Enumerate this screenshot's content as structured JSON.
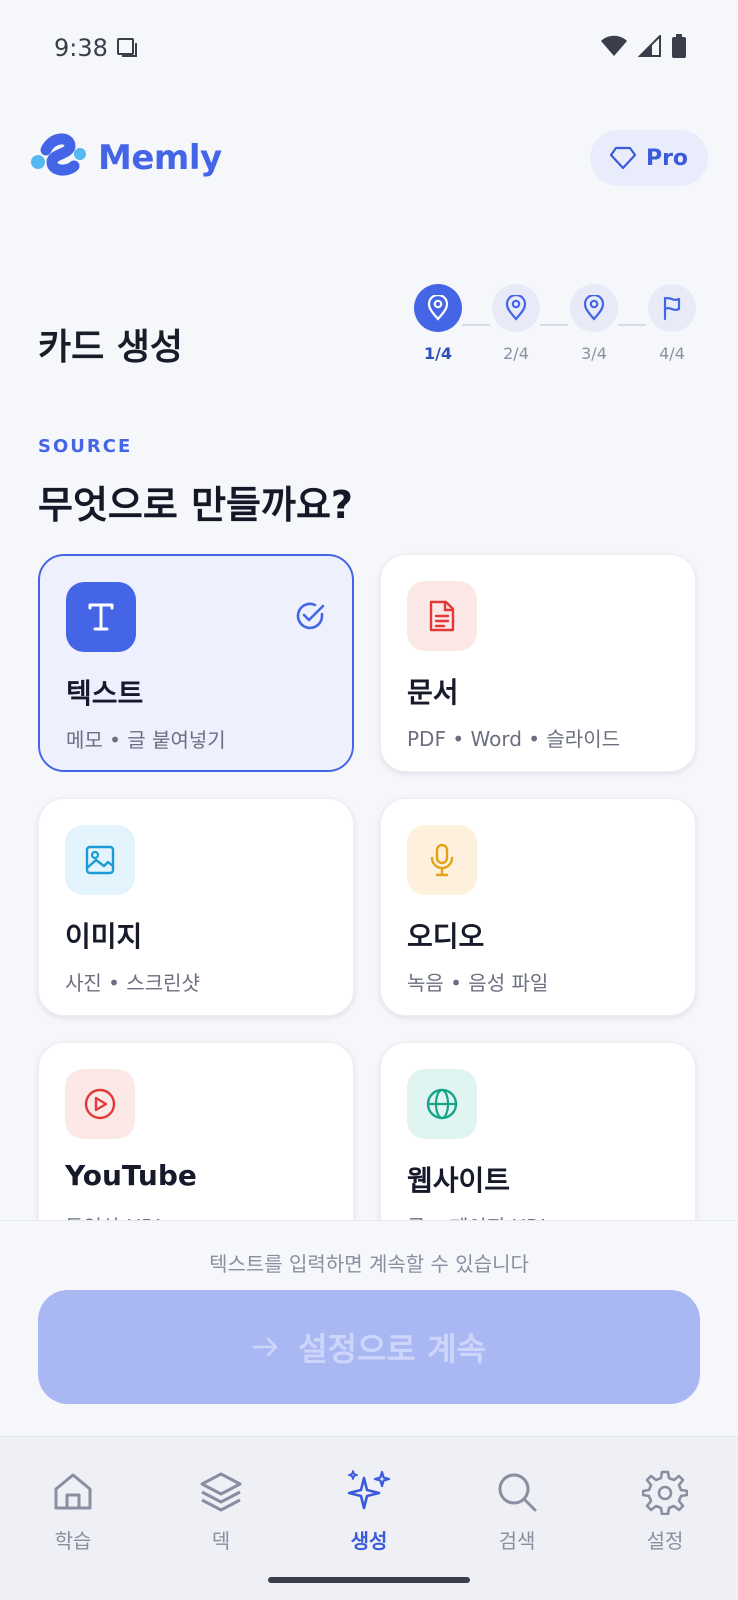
{
  "status_bar": {
    "time": "9:38"
  },
  "header": {
    "app_name": "Memly",
    "pro_label": "Pro"
  },
  "page_title": "카드 생성",
  "stepper": {
    "steps": [
      {
        "label": "1/4",
        "icon": "map-pin-icon"
      },
      {
        "label": "2/4",
        "icon": "map-pin-icon"
      },
      {
        "label": "3/4",
        "icon": "map-pin-icon"
      },
      {
        "label": "4/4",
        "icon": "flag-icon"
      }
    ],
    "active_index": 0
  },
  "section": {
    "eyebrow": "SOURCE",
    "heading": "무엇으로 만들까요?"
  },
  "sources": [
    {
      "title": "텍스트",
      "subtitle": "메모 • 글 붙여넣기",
      "icon": "text-icon",
      "selected": true
    },
    {
      "title": "문서",
      "subtitle": "PDF • Word • 슬라이드",
      "icon": "document-icon"
    },
    {
      "title": "이미지",
      "subtitle": "사진 • 스크린샷",
      "icon": "image-icon"
    },
    {
      "title": "오디오",
      "subtitle": "녹음 • 음성 파일",
      "icon": "microphone-icon"
    },
    {
      "title": "YouTube",
      "subtitle": "동영상 URL",
      "icon": "youtube-play-icon"
    },
    {
      "title": "웹사이트",
      "subtitle": "글 • 페이지 URL",
      "icon": "globe-icon"
    }
  ],
  "footer": {
    "helper": "텍스트를 입력하면 계속할 수 있습니다",
    "continue_label": "설정으로 계속"
  },
  "tabs": [
    {
      "label": "학습",
      "icon": "home-icon"
    },
    {
      "label": "덱",
      "icon": "layers-icon"
    },
    {
      "label": "생성",
      "icon": "sparkles-icon",
      "active": true
    },
    {
      "label": "검색",
      "icon": "search-icon"
    },
    {
      "label": "설정",
      "icon": "gear-icon"
    }
  ],
  "colors": {
    "accent": "#4466e6",
    "background": "#f6f7fb",
    "button_disabled": "#a9b7f3"
  }
}
